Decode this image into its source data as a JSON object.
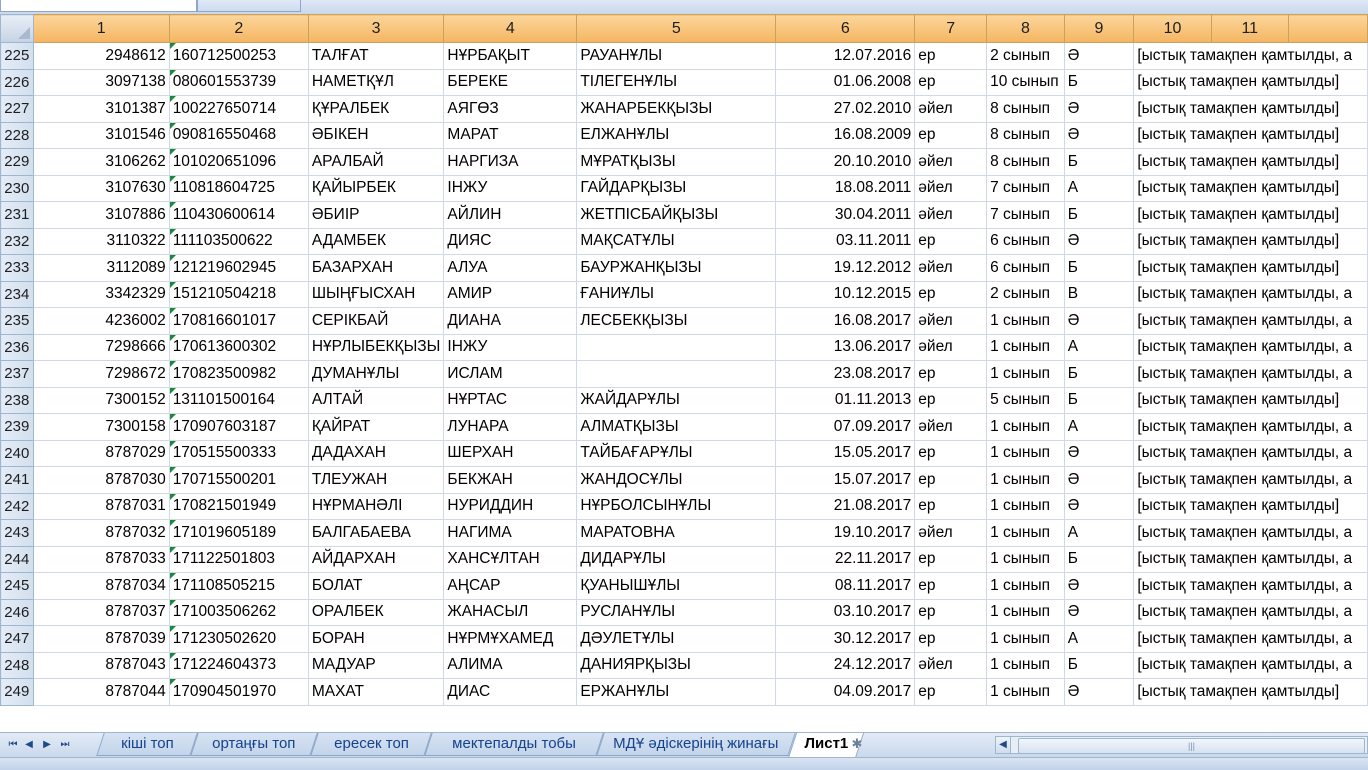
{
  "columns": [
    "1",
    "2",
    "3",
    "4",
    "5",
    "6",
    "7",
    "8",
    "9",
    "10",
    "11"
  ],
  "rows": [
    {
      "n": "225",
      "c1": "2948612",
      "c2": "160712500253",
      "c3": "ТАЛҒАТ",
      "c4": "НҰРБАҚЫТ",
      "c5": "РАУАНҰЛЫ",
      "c6": "12.07.2016",
      "c7": "ер",
      "c8": "2 сынып",
      "c9": "Ә",
      "c10": "[ыстық тамақпен қамтылды, а"
    },
    {
      "n": "226",
      "c1": "3097138",
      "c2": "080601553739",
      "c3": "НАМЕТҚҰЛ",
      "c4": "БЕРЕКЕ",
      "c5": "ТІЛЕГЕНҰЛЫ",
      "c6": "01.06.2008",
      "c7": "ер",
      "c8": "10 сынып",
      "c9": "Б",
      "c10": "[ыстық тамақпен қамтылды]"
    },
    {
      "n": "227",
      "c1": "3101387",
      "c2": "100227650714",
      "c3": "ҚҰРАЛБЕК",
      "c4": "АЯГӨЗ",
      "c5": "ЖАНАРБЕКҚЫЗЫ",
      "c6": "27.02.2010",
      "c7": "әйел",
      "c8": "8 сынып",
      "c9": "Ә",
      "c10": "[ыстық тамақпен қамтылды]"
    },
    {
      "n": "228",
      "c1": "3101546",
      "c2": "090816550468",
      "c3": "ӘБІКЕН",
      "c4": "МАРАТ",
      "c5": "ЕЛЖАНҰЛЫ",
      "c6": "16.08.2009",
      "c7": "ер",
      "c8": "8 сынып",
      "c9": "Ә",
      "c10": "[ыстық тамақпен қамтылды]"
    },
    {
      "n": "229",
      "c1": "3106262",
      "c2": "101020651096",
      "c3": "АРАЛБАЙ",
      "c4": "НАРГИЗА",
      "c5": "МҰРАТҚЫЗЫ",
      "c6": "20.10.2010",
      "c7": "әйел",
      "c8": "8 сынып",
      "c9": "Б",
      "c10": "[ыстық тамақпен қамтылды]"
    },
    {
      "n": "230",
      "c1": "3107630",
      "c2": "110818604725",
      "c3": "ҚАЙЫРБЕК",
      "c4": "ІНЖУ",
      "c5": "ГАЙДАРҚЫЗЫ",
      "c6": "18.08.2011",
      "c7": "әйел",
      "c8": "7 сынып",
      "c9": "А",
      "c10": "[ыстық тамақпен қамтылды]"
    },
    {
      "n": "231",
      "c1": "3107886",
      "c2": "110430600614",
      "c3": "ӘБИІР",
      "c4": "АЙЛИН",
      "c5": "ЖЕТПІСБАЙҚЫЗЫ",
      "c6": "30.04.2011",
      "c7": "әйел",
      "c8": "7 сынып",
      "c9": "Б",
      "c10": "[ыстық тамақпен қамтылды]"
    },
    {
      "n": "232",
      "c1": "3110322",
      "c2": "111103500622",
      "c3": "АДАМБЕК",
      "c4": "ДИЯС",
      "c5": "МАҚСАТҰЛЫ",
      "c6": "03.11.2011",
      "c7": "ер",
      "c8": "6 сынып",
      "c9": "Ә",
      "c10": "[ыстық тамақпен қамтылды]"
    },
    {
      "n": "233",
      "c1": "3112089",
      "c2": "121219602945",
      "c3": "БАЗАРХАН",
      "c4": "АЛУА",
      "c5": "БАУРЖАНҚЫЗЫ",
      "c6": "19.12.2012",
      "c7": "әйел",
      "c8": "6 сынып",
      "c9": "Б",
      "c10": "[ыстық тамақпен қамтылды]"
    },
    {
      "n": "234",
      "c1": "3342329",
      "c2": "151210504218",
      "c3": "ШЫҢҒЫСХАН",
      "c4": "АМИР",
      "c5": "ҒАНИҰЛЫ",
      "c6": "10.12.2015",
      "c7": "ер",
      "c8": "2 сынып",
      "c9": "В",
      "c10": "[ыстық тамақпен қамтылды, а"
    },
    {
      "n": "235",
      "c1": "4236002",
      "c2": "170816601017",
      "c3": "СЕРІКБАЙ",
      "c4": "ДИАНА",
      "c5": "ЛЕСБЕКҚЫЗЫ",
      "c6": "16.08.2017",
      "c7": "әйел",
      "c8": "1 сынып",
      "c9": "Ә",
      "c10": "[ыстық тамақпен қамтылды, а"
    },
    {
      "n": "236",
      "c1": "7298666",
      "c2": "170613600302",
      "c3": "НҰРЛЫБЕКҚЫЗЫ",
      "c4": "ІНЖУ",
      "c5": "",
      "c6": "13.06.2017",
      "c7": "әйел",
      "c8": "1 сынып",
      "c9": "А",
      "c10": "[ыстық тамақпен қамтылды, а"
    },
    {
      "n": "237",
      "c1": "7298672",
      "c2": "170823500982",
      "c3": "ДУМАНҰЛЫ",
      "c4": "ИСЛАМ",
      "c5": "",
      "c6": "23.08.2017",
      "c7": "ер",
      "c8": "1 сынып",
      "c9": "Б",
      "c10": "[ыстық тамақпен қамтылды, а"
    },
    {
      "n": "238",
      "c1": "7300152",
      "c2": "131101500164",
      "c3": "АЛТАЙ",
      "c4": "НҰРТАС",
      "c5": "ЖАЙДАРҰЛЫ",
      "c6": "01.11.2013",
      "c7": "ер",
      "c8": "5 сынып",
      "c9": "Б",
      "c10": "[ыстық тамақпен қамтылды]"
    },
    {
      "n": "239",
      "c1": "7300158",
      "c2": "170907603187",
      "c3": "ҚАЙРАТ",
      "c4": "ЛУНАРА",
      "c5": "АЛМАТҚЫЗЫ",
      "c6": "07.09.2017",
      "c7": "әйел",
      "c8": "1 сынып",
      "c9": "А",
      "c10": "[ыстық тамақпен қамтылды, а"
    },
    {
      "n": "240",
      "c1": "8787029",
      "c2": "170515500333",
      "c3": "ДАДАХАН",
      "c4": "ШЕРХАН",
      "c5": "ТАЙБАҒАРҰЛЫ",
      "c6": "15.05.2017",
      "c7": "ер",
      "c8": "1 сынып",
      "c9": "Ә",
      "c10": "[ыстық тамақпен қамтылды, а"
    },
    {
      "n": "241",
      "c1": "8787030",
      "c2": "170715500201",
      "c3": "ТЛЕУЖАН",
      "c4": "БЕКЖАН",
      "c5": "ЖАНДОСҰЛЫ",
      "c6": "15.07.2017",
      "c7": "ер",
      "c8": "1 сынып",
      "c9": "Ә",
      "c10": "[ыстық тамақпен қамтылды, а"
    },
    {
      "n": "242",
      "c1": "8787031",
      "c2": "170821501949",
      "c3": "НҰРМАНӘЛІ",
      "c4": "НУРИДДИН",
      "c5": "НҰРБОЛСЫНҰЛЫ",
      "c6": "21.08.2017",
      "c7": "ер",
      "c8": "1 сынып",
      "c9": "Ә",
      "c10": "[ыстық тамақпен қамтылды]"
    },
    {
      "n": "243",
      "c1": "8787032",
      "c2": "171019605189",
      "c3": "БАЛГАБАЕВА",
      "c4": "НАГИМА",
      "c5": "МАРАТОВНА",
      "c6": "19.10.2017",
      "c7": "әйел",
      "c8": "1 сынып",
      "c9": "А",
      "c10": "[ыстық тамақпен қамтылды, а"
    },
    {
      "n": "244",
      "c1": "8787033",
      "c2": "171122501803",
      "c3": "АЙДАРХАН",
      "c4": "ХАНСҰЛТАН",
      "c5": "ДИДАРҰЛЫ",
      "c6": "22.11.2017",
      "c7": "ер",
      "c8": "1 сынып",
      "c9": "Б",
      "c10": "[ыстық тамақпен қамтылды, а"
    },
    {
      "n": "245",
      "c1": "8787034",
      "c2": "171108505215",
      "c3": "БОЛАТ",
      "c4": "АҢСАР",
      "c5": "ҚУАНЫШҰЛЫ",
      "c6": "08.11.2017",
      "c7": "ер",
      "c8": "1 сынып",
      "c9": "Ә",
      "c10": "[ыстық тамақпен қамтылды, а"
    },
    {
      "n": "246",
      "c1": "8787037",
      "c2": "171003506262",
      "c3": "ОРАЛБЕК",
      "c4": "ЖАНАСЫЛ",
      "c5": "РУСЛАНҰЛЫ",
      "c6": "03.10.2017",
      "c7": "ер",
      "c8": "1 сынып",
      "c9": "Ә",
      "c10": "[ыстық тамақпен қамтылды, а"
    },
    {
      "n": "247",
      "c1": "8787039",
      "c2": "171230502620",
      "c3": "БОРАН",
      "c4": "НҰРМҰХАМЕД",
      "c5": "ДӘУЛЕТҰЛЫ",
      "c6": "30.12.2017",
      "c7": "ер",
      "c8": "1 сынып",
      "c9": "А",
      "c10": "[ыстық тамақпен қамтылды, а"
    },
    {
      "n": "248",
      "c1": "8787043",
      "c2": "171224604373",
      "c3": "МАДУАР",
      "c4": "АЛИМА",
      "c5": "ДАНИЯРҚЫЗЫ",
      "c6": "24.12.2017",
      "c7": "әйел",
      "c8": "1 сынып",
      "c9": "Б",
      "c10": "[ыстық тамақпен қамтылды, а"
    },
    {
      "n": "249",
      "c1": "8787044",
      "c2": "170904501970",
      "c3": "МАХАТ",
      "c4": "ДИАС",
      "c5": "ЕРЖАНҰЛЫ",
      "c6": "04.09.2017",
      "c7": "ер",
      "c8": "1 сынып",
      "c9": "Ә",
      "c10": "[ыстық тамақпен қамтылды]"
    }
  ],
  "sheet_tabs": [
    "кіші топ",
    "ортаңғы топ",
    "ересек топ",
    "мектепалды тобы",
    "МДҰ әдіскерінің жинағы",
    "Лист1"
  ],
  "active_tab": "Лист1",
  "nav": {
    "first": "⏮",
    "prev": "◀",
    "next": "▶",
    "last": "⏭"
  },
  "new_sheet_glyph": "✱",
  "colors": {
    "header_bg": "#f5b561",
    "grid_line": "#d0d7e5",
    "iin_flag": "#1a8a3a",
    "tab_text": "#15428b"
  }
}
